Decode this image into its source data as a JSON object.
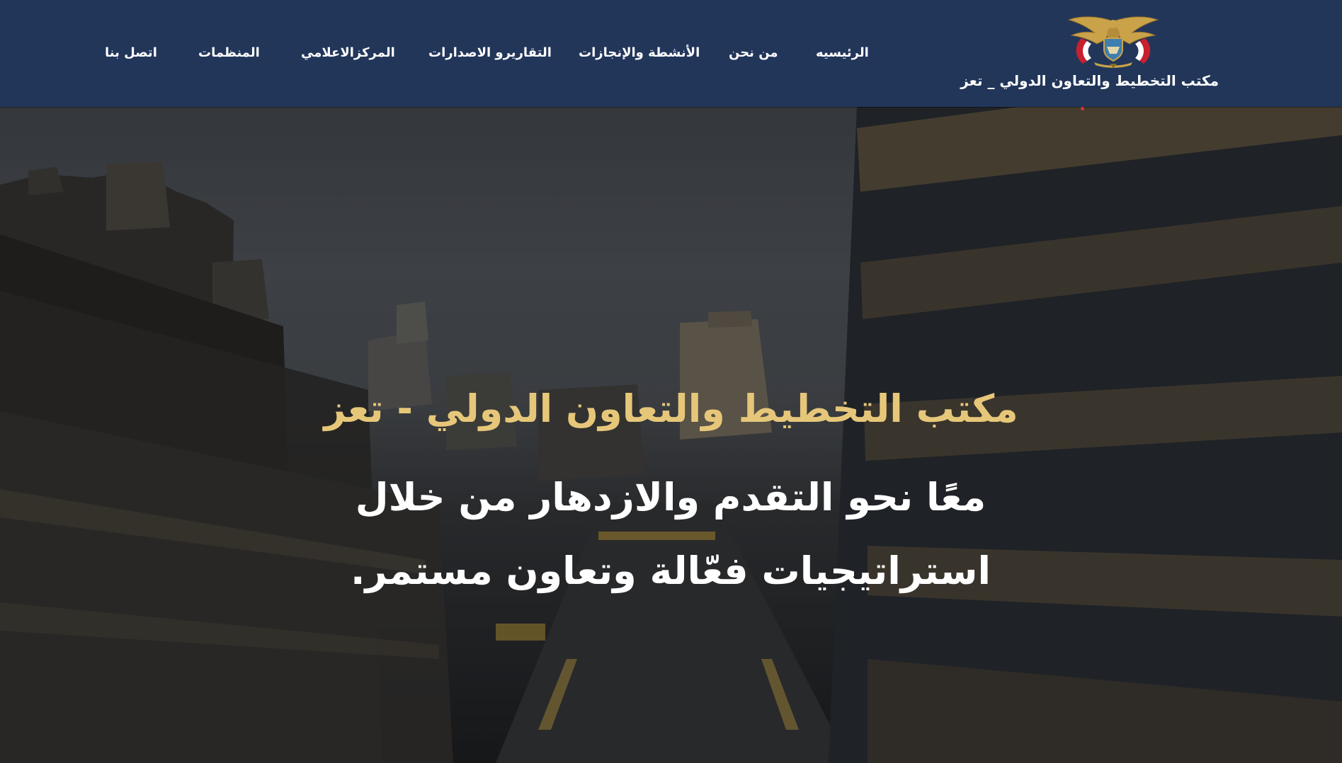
{
  "header": {
    "logo_text": "مكتب التخطيط والتعاون الدولي _ تعز",
    "nav": [
      {
        "label": "الرئيسيه"
      },
      {
        "label": "من نحن"
      },
      {
        "label": "الأنشطة والإنجازات"
      },
      {
        "label": "التقاريرو الاصدارات"
      },
      {
        "label": "المركزالاعلامي"
      },
      {
        "label": "المنظمات"
      },
      {
        "label": "اتصل بنا"
      }
    ]
  },
  "hero": {
    "title": "مكتب التخطيط والتعاون الدولي - تعز",
    "subtitle": "معًا نحو التقدم والازدهار من خلال استراتيجيات فعّالة وتعاون مستمر."
  },
  "colors": {
    "navbar_bg": "#22365a",
    "hero_title": "#e6c77a",
    "hero_subtitle": "#ffffff",
    "emblem_gold": "#c9a24a",
    "flag_red": "#c8202e"
  },
  "icons": {
    "logo": "yemen-eagle-emblem-icon"
  }
}
